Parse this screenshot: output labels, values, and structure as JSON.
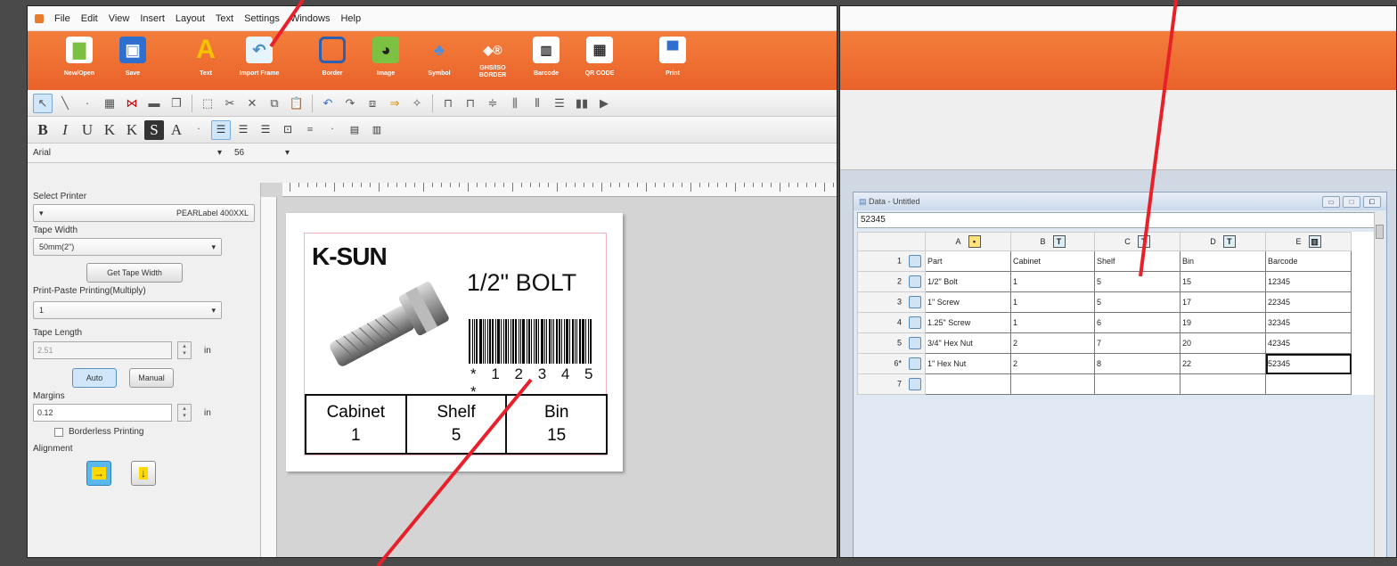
{
  "left_app": {
    "menu": [
      "File",
      "Edit",
      "View",
      "Insert",
      "Layout",
      "Text",
      "Settings",
      "Windows",
      "Help"
    ],
    "ribbon": [
      {
        "label": "New/Open",
        "icon": "new-document-icon",
        "color": "#7ac142"
      },
      {
        "label": "Save",
        "icon": "floppy-disk-icon",
        "color": "#2f6fd0"
      },
      {
        "label": "Text",
        "icon": "text-a-icon",
        "color": "#f5c400"
      },
      {
        "label": "Import Frame",
        "icon": "import-frame-icon",
        "color": "#5aa7e0"
      },
      {
        "label": "Border",
        "icon": "border-icon",
        "color": "#2e5fb0"
      },
      {
        "label": "Image",
        "icon": "image-icon",
        "color": "#7cc142"
      },
      {
        "label": "Symbol",
        "icon": "symbol-icon",
        "color": "#4a90e2"
      },
      {
        "label": "GHS/ISO BORDER",
        "icon": "ghs-iso-border-icon",
        "color": "#ffffff"
      },
      {
        "label": "Barcode",
        "icon": "barcode-icon",
        "color": "#ffffff"
      },
      {
        "label": "QR CODE",
        "icon": "qr-code-icon",
        "color": "#ffffff"
      },
      {
        "label": "Print",
        "icon": "printer-icon",
        "color": "#2f6fd0"
      }
    ],
    "font": {
      "family": "Arial",
      "size": "56"
    },
    "panel": {
      "select_printer_label": "Select Printer",
      "printer_value": "PEARLabel 400XXL",
      "tape_width_label": "Tape Width",
      "tape_width_value": "50mm(2\")",
      "get_tape_width_btn": "Get Tape Width",
      "print_paste_label": "Print-Paste Printing(Multiply)",
      "print_paste_value": "1",
      "tape_length_label": "Tape Length",
      "tape_length_value": "2.51",
      "unit_in": "in",
      "auto_btn": "Auto",
      "manual_btn": "Manual",
      "margins_label": "Margins",
      "margins_value": "0.12",
      "borderless_label": "Borderless Printing",
      "alignment_label": "Alignment"
    },
    "label": {
      "brand": "K-SUN",
      "title": "1/2\" BOLT",
      "barcode_text": "* 1 2 3 4 5 *",
      "table": [
        {
          "header": "Cabinet",
          "value": "1"
        },
        {
          "header": "Shelf",
          "value": "5"
        },
        {
          "header": "Bin",
          "value": "15"
        }
      ]
    }
  },
  "right_app": {
    "data_window_title": "Data - Untitled",
    "formula_value": "52345",
    "columns": [
      {
        "letter": "A",
        "type_icon": "•"
      },
      {
        "letter": "B",
        "type_icon": "T"
      },
      {
        "letter": "C",
        "type_icon": "T"
      },
      {
        "letter": "D",
        "type_icon": "T"
      },
      {
        "letter": "E",
        "type_icon": "▥"
      }
    ],
    "rows": [
      {
        "num": "1",
        "cells": [
          "Part",
          "Cabinet",
          "Shelf",
          "Bin",
          "Barcode"
        ]
      },
      {
        "num": "2",
        "cells": [
          "1/2\" Bolt",
          "1",
          "5",
          "15",
          "12345"
        ]
      },
      {
        "num": "3",
        "cells": [
          "1\" Screw",
          "1",
          "5",
          "17",
          "22345"
        ]
      },
      {
        "num": "4",
        "cells": [
          "1.25\" Screw",
          "1",
          "6",
          "19",
          "32345"
        ]
      },
      {
        "num": "5",
        "cells": [
          "3/4\" Hex Nut",
          "2",
          "7",
          "20",
          "42345"
        ]
      },
      {
        "num": "6*",
        "cells": [
          "1\" Hex Nut",
          "2",
          "8",
          "22",
          "52345"
        ]
      },
      {
        "num": "7",
        "cells": [
          "",
          "",
          "",
          "",
          ""
        ]
      }
    ]
  },
  "colors": {
    "ribbon_orange": "#ee6d30",
    "annotation_red": "#e8202a"
  }
}
